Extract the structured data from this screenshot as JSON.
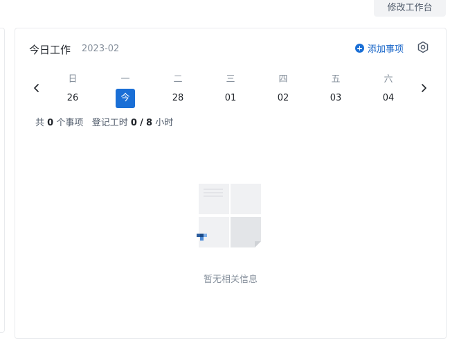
{
  "header": {
    "modify_button": "修改工作台"
  },
  "card": {
    "title": "今日工作",
    "date": "2023-02",
    "add_item_label": "添加事项",
    "weekdays": [
      "日",
      "一",
      "二",
      "三",
      "四",
      "五",
      "六"
    ],
    "days": [
      "26",
      "今",
      "28",
      "01",
      "02",
      "03",
      "04"
    ],
    "today_index": 1,
    "summary": {
      "prefix": "共",
      "item_count": "0",
      "item_suffix": "个事项",
      "hours_label": "登记工时",
      "hours_logged": "0",
      "separator": "/",
      "hours_total": "8",
      "hours_unit": "小时"
    },
    "empty_text": "暂无相关信息"
  },
  "colors": {
    "accent": "#1a6fd6",
    "text_primary": "#1f2329",
    "text_secondary": "#86909c",
    "border": "#e8eaed"
  }
}
